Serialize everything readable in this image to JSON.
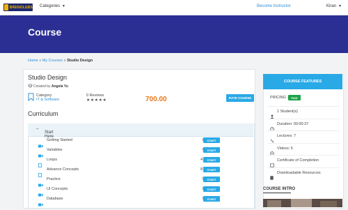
{
  "header": {
    "logo_text": "BRENOLEBS",
    "categories_label": "Categories",
    "become_instructor": "Become Instructor",
    "user_name": "Kiran"
  },
  "hero": {
    "title": "Course"
  },
  "breadcrumb": {
    "home": "Home",
    "sep1": " » ",
    "my_courses": "My Courses",
    "sep2": " » ",
    "current": "Studio Design"
  },
  "course": {
    "title": "Studio Design",
    "created_by_prefix": "Created by",
    "author": "Angela Yu",
    "category_label": "Category",
    "category_value": "IT & Software",
    "reviews": "0 Reviews",
    "stars": "★★★★★",
    "price": "700.00",
    "rate_button": "RATE COURSE"
  },
  "curriculum": {
    "heading": "Curriculum",
    "section_title": "Start Here",
    "start_label": "START",
    "lessons": [
      {
        "title": "Getting Started",
        "meta": "00:02:24",
        "icon": "video-icon"
      },
      {
        "title": "Variables",
        "meta": "00:00:37",
        "icon": "video-icon"
      },
      {
        "title": "Loops",
        "meta": "4 Page(s)",
        "icon": "document-icon"
      },
      {
        "title": "Advance Concepts",
        "meta": "8 Page(s)",
        "icon": "document-icon"
      },
      {
        "title": "Practice",
        "meta": "00:00:51",
        "icon": "video-icon"
      },
      {
        "title": "UI Concepts",
        "meta": "00:00:51",
        "icon": "video-icon"
      },
      {
        "title": "Database",
        "meta": "00:00:37",
        "icon": "video-icon"
      }
    ]
  },
  "features": {
    "heading": "COURSE FEATURES",
    "pricing_label": "PRICING :",
    "pricing_badge": "PAID",
    "items": [
      {
        "text": "1 Student(s)",
        "icon": "user-icon"
      },
      {
        "text": "Duration: 00:00:37",
        "icon": "clock-icon"
      },
      {
        "text": "Lectures: 7",
        "icon": "lectures-icon"
      },
      {
        "text": "Videos: 5",
        "icon": "play-icon"
      },
      {
        "text": "Certificate of Completion",
        "icon": "certificate-icon"
      },
      {
        "text": "Downloadable Resources",
        "icon": "download-icon"
      }
    ]
  },
  "intro": {
    "heading": "COURSE INTRO"
  },
  "colors": {
    "hero": "#2b2f93",
    "accent": "#29a9e6",
    "price": "#e8761a",
    "paid": "#1fa34a"
  }
}
